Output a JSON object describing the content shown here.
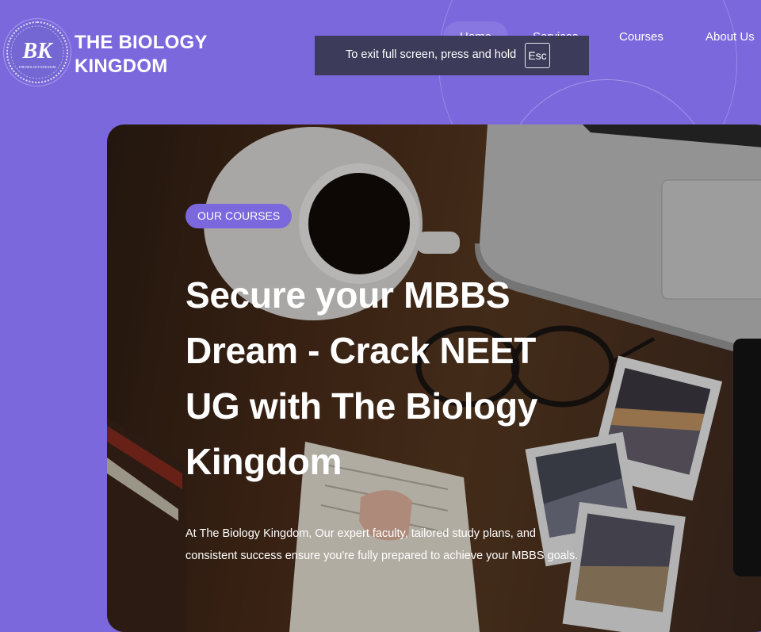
{
  "brand": {
    "logo_text": "BK",
    "logo_subtext": "THE BIOLOGY KINGDOM",
    "name_line1": "THE BIOLOGY",
    "name_line2": "KINGDOM"
  },
  "nav": {
    "items": [
      {
        "label": "Home"
      },
      {
        "label": "Services"
      },
      {
        "label": "Courses"
      },
      {
        "label": "About Us"
      }
    ]
  },
  "fullscreen_notice": {
    "text": "To exit full screen, press and hold",
    "key": "Esc"
  },
  "hero": {
    "badge": "OUR COURSES",
    "title": "Secure your MBBS Dream - Crack NEET UG with The Biology Kingdom",
    "description": "At The Biology Kingdom, Our expert faculty, tailored study plans, and consistent success ensure you're fully prepared to achieve your MBBS goals."
  },
  "colors": {
    "background": "#7b68dd",
    "accent": "#7b68dd",
    "toast": "#3c3b5a",
    "text": "#ffffff"
  }
}
